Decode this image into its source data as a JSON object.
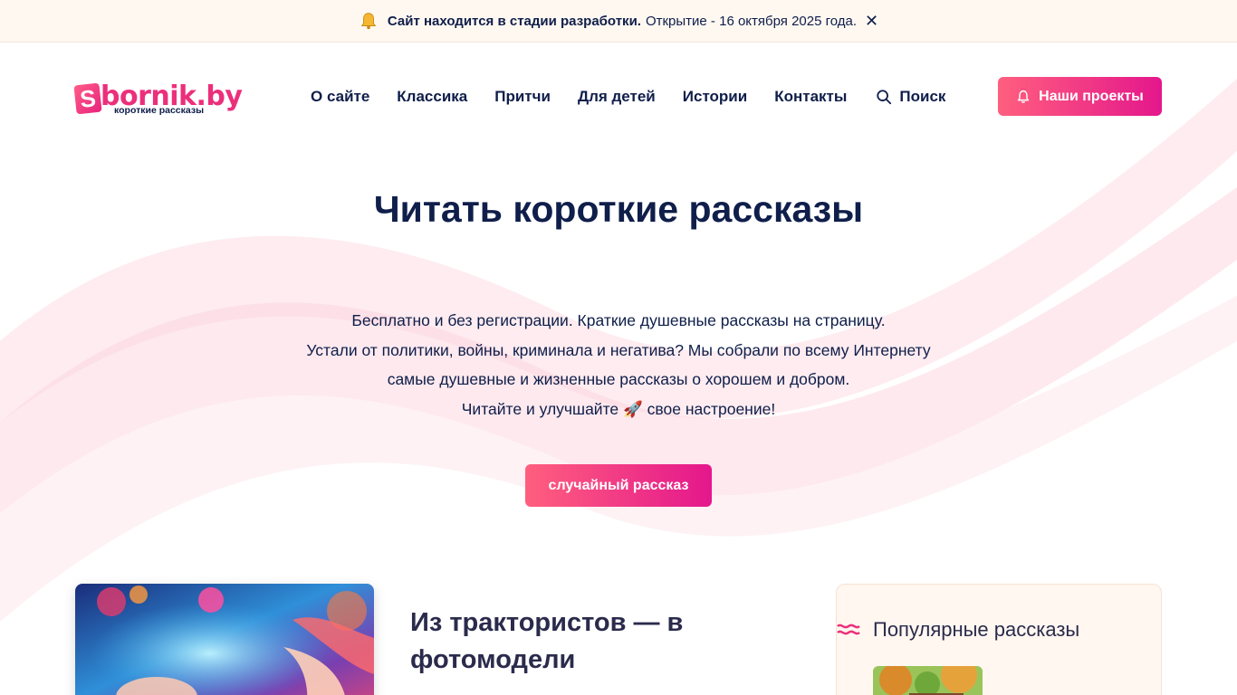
{
  "announcement": {
    "strong": "Сайт находится в стадии разработки.",
    "text": "Открытие - 16 октября 2025 года.",
    "close": "✕"
  },
  "logo": {
    "mark": "S",
    "word": "bornik.by",
    "tagline": "короткие рассказы"
  },
  "nav": {
    "items": [
      "О сайте",
      "Классика",
      "Притчи",
      "Для детей",
      "Истории",
      "Контакты"
    ],
    "search_label": "Поиск"
  },
  "header_cta": "Наши проекты",
  "hero": {
    "title": "Читать короткие рассказы",
    "lines": [
      "Бесплатно и без регистрации. Краткие душевные рассказы на страницу.",
      "Устали от политики, войны, криминала и негатива? Мы собрали по всему Интернету",
      "самые душевные и жизненные рассказы о хорошем и добром.",
      "Читайте и улучшайте 🚀 свое настроение!"
    ],
    "button": "случайный рассказ"
  },
  "article": {
    "title": "Из трактористов — в фотомодели"
  },
  "popular": {
    "title": "Популярные рассказы"
  },
  "colors": {
    "brand": "#ec2f7b",
    "gradient_start": "#ff5f7e",
    "gradient_end": "#e4178c",
    "text": "#0f1e4a",
    "topbar_bg": "#fff8f1"
  },
  "icons": {
    "announcement": "bell-icon",
    "close": "close-icon",
    "search": "search-icon",
    "cta": "bell-outline-icon",
    "popular": "waves-icon"
  }
}
